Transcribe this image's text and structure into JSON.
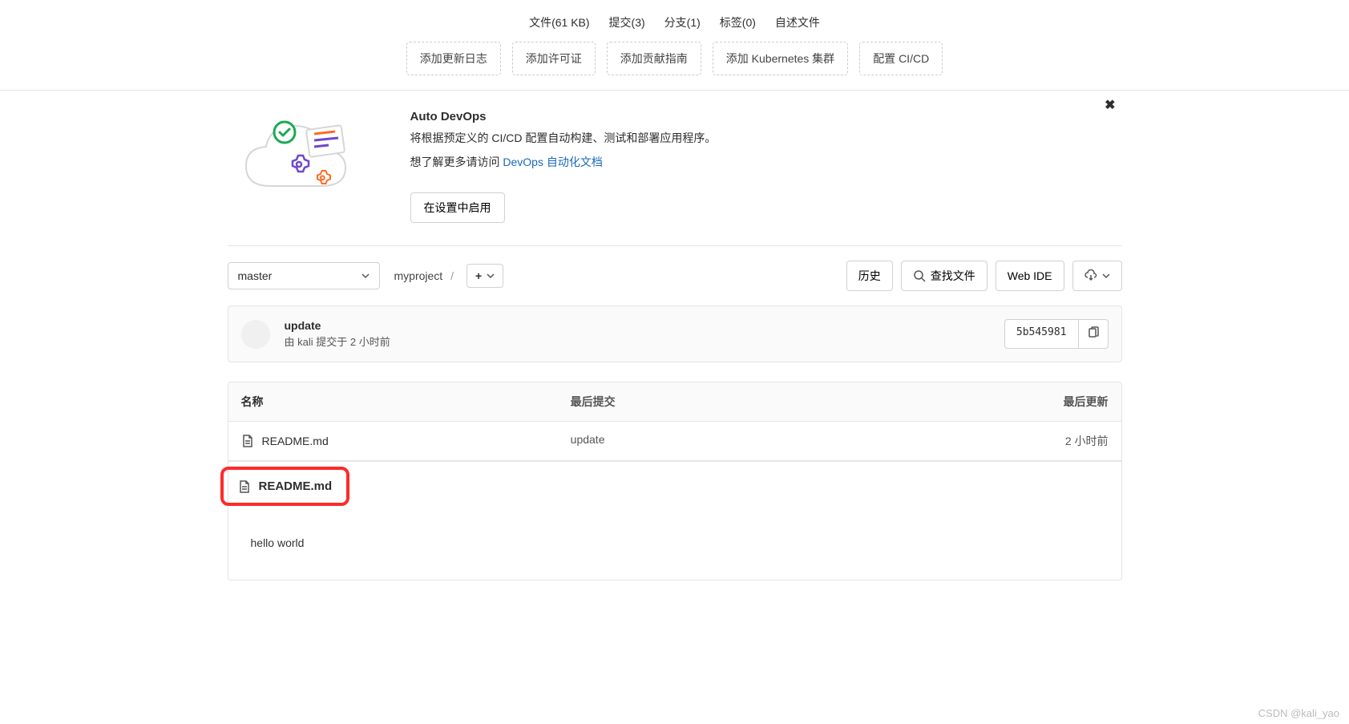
{
  "stats": {
    "files": "文件(61 KB)",
    "commits": "提交(3)",
    "branches": "分支(1)",
    "tags": "标签(0)",
    "readme": "自述文件"
  },
  "quickActions": {
    "changelog": "添加更新日志",
    "license": "添加许可证",
    "contributing": "添加贡献指南",
    "kubernetes": "添加 Kubernetes 集群",
    "cicd": "配置 CI/CD"
  },
  "devops": {
    "title": "Auto DevOps",
    "description": "将根据预定义的 CI/CD 配置自动构建、测试和部署应用程序。",
    "morePrefix": "想了解更多请访问 ",
    "linkText": "DevOps 自动化文档",
    "enableLabel": "在设置中启用"
  },
  "tree": {
    "branch": "master",
    "project": "myproject",
    "separator": "/"
  },
  "controls": {
    "history": "历史",
    "findFile": "查找文件",
    "webIde": "Web IDE"
  },
  "commit": {
    "message": "update",
    "metaPrefix": "由 ",
    "author": "kali",
    "metaMiddle": " 提交于 ",
    "time": "2 小时前",
    "sha": "5b545981"
  },
  "table": {
    "headers": {
      "name": "名称",
      "lastCommit": "最后提交",
      "lastUpdated": "最后更新"
    },
    "rows": [
      {
        "name": "README.md",
        "commit": "update",
        "updated": "2 小时前"
      }
    ]
  },
  "readme": {
    "filename": "README.md",
    "content": "hello world"
  },
  "watermark": "CSDN @kali_yao"
}
